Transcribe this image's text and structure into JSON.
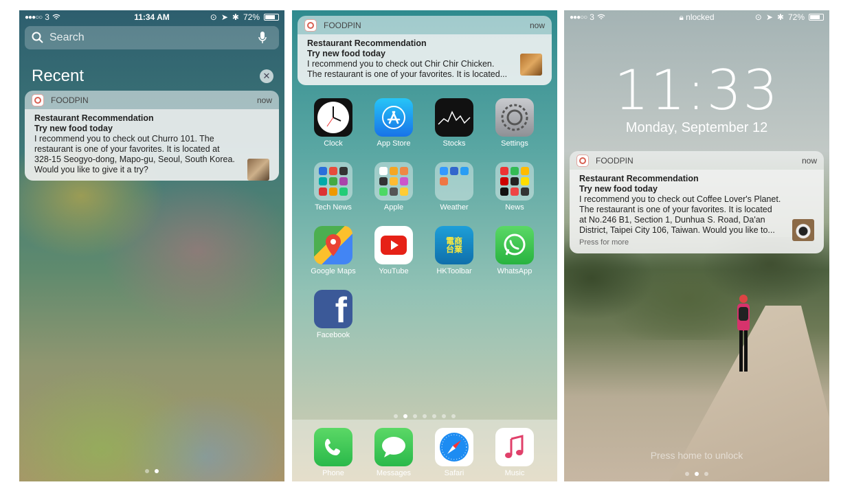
{
  "screen1": {
    "status": {
      "carrier": "3",
      "time": "11:34 AM",
      "battery": "72%"
    },
    "search": {
      "placeholder": "Search"
    },
    "recent_label": "Recent",
    "notification": {
      "app": "FOODPIN",
      "time": "now",
      "title": "Restaurant Recommendation",
      "subtitle": "Try new food today",
      "body": "I recommend you to check out Churro 101. The restaurant is one of your favorites. It is located at 328-15 Seogyo-dong, Mapo-gu, Seoul, South Korea. Would you like to give it a try?"
    }
  },
  "screen2": {
    "notification": {
      "app": "FOODPIN",
      "time": "now",
      "title": "Restaurant Recommendation",
      "subtitle": "Try new food today",
      "body": "I recommend you to check out Chir Chir Chicken. The restaurant is one of your favorites. It is located..."
    },
    "apps": [
      {
        "label": "Clock"
      },
      {
        "label": "App Store"
      },
      {
        "label": "Stocks"
      },
      {
        "label": "Settings"
      },
      {
        "label": "Tech News"
      },
      {
        "label": "Apple"
      },
      {
        "label": "Weather"
      },
      {
        "label": "News"
      },
      {
        "label": "Google Maps"
      },
      {
        "label": "YouTube"
      },
      {
        "label": "HKToolbar"
      },
      {
        "label": "WhatsApp"
      },
      {
        "label": "Facebook"
      }
    ],
    "hk_icon_text": "電商台業",
    "dock": [
      {
        "label": "Phone"
      },
      {
        "label": "Messages"
      },
      {
        "label": "Safari"
      },
      {
        "label": "Music"
      }
    ]
  },
  "screen3": {
    "status": {
      "carrier": "3",
      "center": "nlocked",
      "battery": "72%"
    },
    "time": "11:33",
    "date": "Monday, September 12",
    "notification": {
      "app": "FOODPIN",
      "time": "now",
      "title": "Restaurant Recommendation",
      "subtitle": "Try new food today",
      "body": "I recommend you to check out Coffee Lover's Planet. The restaurant is one of your favorites. It is located at No.246 B1, Section 1, Dunhua S. Road, Da'an District, Taipei City 106, Taiwan. Would you like to...",
      "press_more": "Press for more"
    },
    "hint": "Press home to unlock"
  }
}
